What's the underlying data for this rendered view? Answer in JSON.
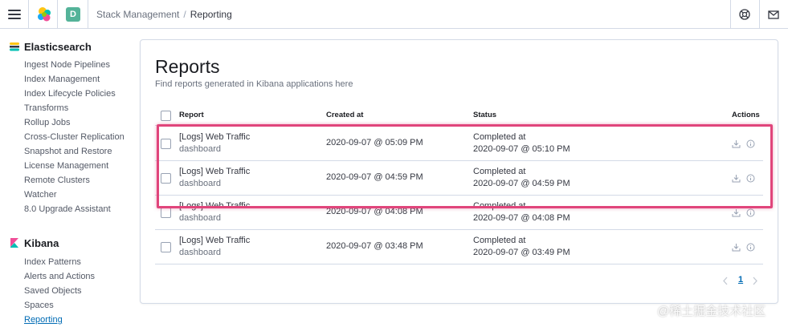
{
  "header": {
    "space_initial": "D",
    "breadcrumbs": [
      "Stack Management",
      "Reporting"
    ]
  },
  "sidebar": {
    "sections": [
      {
        "title": "Elasticsearch",
        "items": [
          "Ingest Node Pipelines",
          "Index Management",
          "Index Lifecycle Policies",
          "Transforms",
          "Rollup Jobs",
          "Cross-Cluster Replication",
          "Snapshot and Restore",
          "License Management",
          "Remote Clusters",
          "Watcher",
          "8.0 Upgrade Assistant"
        ]
      },
      {
        "title": "Kibana",
        "items": [
          "Index Patterns",
          "Alerts and Actions",
          "Saved Objects",
          "Spaces",
          "Reporting"
        ],
        "active": "Reporting"
      }
    ]
  },
  "main": {
    "title": "Reports",
    "subtitle": "Find reports generated in Kibana applications here",
    "columns": [
      "Report",
      "Created at",
      "Status",
      "Actions"
    ],
    "rows": [
      {
        "report": "[Logs] Web Traffic",
        "type": "dashboard",
        "created": "2020-09-07 @ 05:09 PM",
        "status": "Completed at",
        "status_time": "2020-09-07 @ 05:10 PM"
      },
      {
        "report": "[Logs] Web Traffic",
        "type": "dashboard",
        "created": "2020-09-07 @ 04:59 PM",
        "status": "Completed at",
        "status_time": "2020-09-07 @ 04:59 PM"
      },
      {
        "report": "[Logs] Web Traffic",
        "type": "dashboard",
        "created": "2020-09-07 @ 04:08 PM",
        "status": "Completed at",
        "status_time": "2020-09-07 @ 04:08 PM"
      },
      {
        "report": "[Logs] Web Traffic",
        "type": "dashboard",
        "created": "2020-09-07 @ 03:48 PM",
        "status": "Completed at",
        "status_time": "2020-09-07 @ 03:49 PM"
      }
    ],
    "pagination": {
      "current_page": "1"
    }
  },
  "watermark": "@稀土掘金技术社区",
  "colors": {
    "accent": "#006bb4",
    "highlight": "#e0457b",
    "space_badge": "#54b399",
    "border": "#d3dae6"
  },
  "icons": {
    "menu": "hamburger-icon",
    "logo": "elastic-logo",
    "help": "help-icon",
    "mail": "mail-icon",
    "download": "download-icon",
    "info": "info-icon",
    "prev": "chevron-left-icon",
    "next": "chevron-right-icon"
  }
}
